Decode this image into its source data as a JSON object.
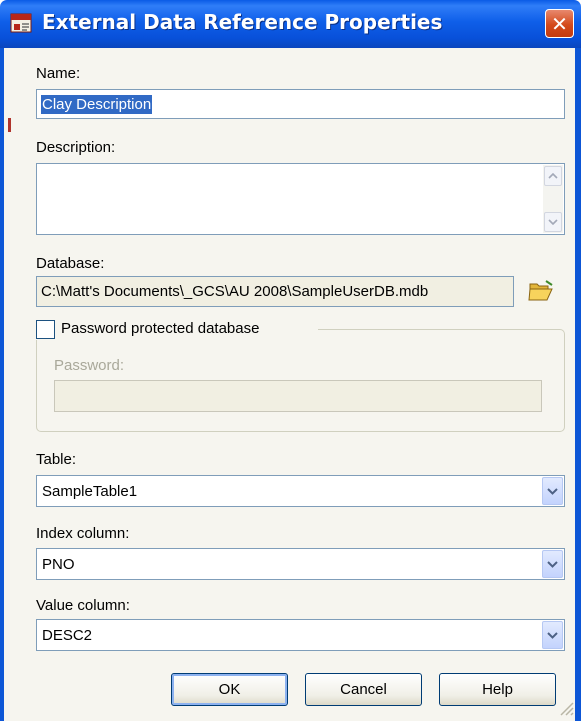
{
  "window": {
    "title": "External Data Reference Properties",
    "close_glyph": "✕"
  },
  "name": {
    "label": "Name:",
    "value": "Clay Description"
  },
  "description": {
    "label": "Description:",
    "value": ""
  },
  "database": {
    "label": "Database:",
    "path": "C:\\Matt's Documents\\_GCS\\AU 2008\\SampleUserDB.mdb",
    "browse_icon": "folder-open-icon"
  },
  "password_protected": {
    "label": "Password protected database",
    "checked": false
  },
  "password": {
    "label": "Password:",
    "value": ""
  },
  "table": {
    "label": "Table:",
    "value": "SampleTable1"
  },
  "index_column": {
    "label": "Index column:",
    "value": "PNO"
  },
  "value_column": {
    "label": "Value column:",
    "value": "DESC2"
  },
  "buttons": {
    "ok": "OK",
    "cancel": "Cancel",
    "help": "Help"
  },
  "colors": {
    "titlebar": "#0a5be6",
    "close_button": "#d44a1c",
    "dialog_background": "#f6f5ef",
    "selection": "#316ac5",
    "field_border": "#7f9db9"
  }
}
